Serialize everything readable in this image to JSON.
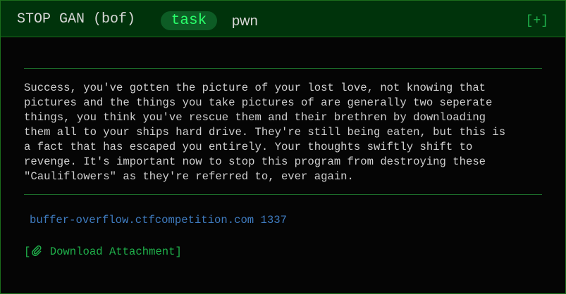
{
  "challenge": {
    "title": "STOP GAN (bof)",
    "badge": "task",
    "category": "pwn",
    "expand_label": "[+]",
    "description": "Success, you've gotten the picture of your lost love, not knowing that\npictures and the things you take pictures of are generally two seperate\nthings, you think you've rescue them and their brethren by downloading\nthem all to your ships hard drive. They're still being eaten, but this is\na fact that has escaped you entirely. Your thoughts swiftly shift to\nrevenge. It's important now to stop this program from destroying these\n\"Cauliflowers\" as they're referred to, ever again.",
    "host": "buffer-overflow.ctfcompetition.com 1337",
    "download": {
      "open_bracket": "[",
      "icon": "paperclip-icon",
      "label": "Download Attachment",
      "close_bracket": "]"
    }
  },
  "colors": {
    "header_bg": "#00330b",
    "border": "#1b6e1b",
    "badge_bg": "#0d5c25",
    "badge_text": "#29ff6a",
    "accent_green": "#1fb14b",
    "link_blue": "#3f7cc0",
    "text": "#d0d0d0"
  }
}
